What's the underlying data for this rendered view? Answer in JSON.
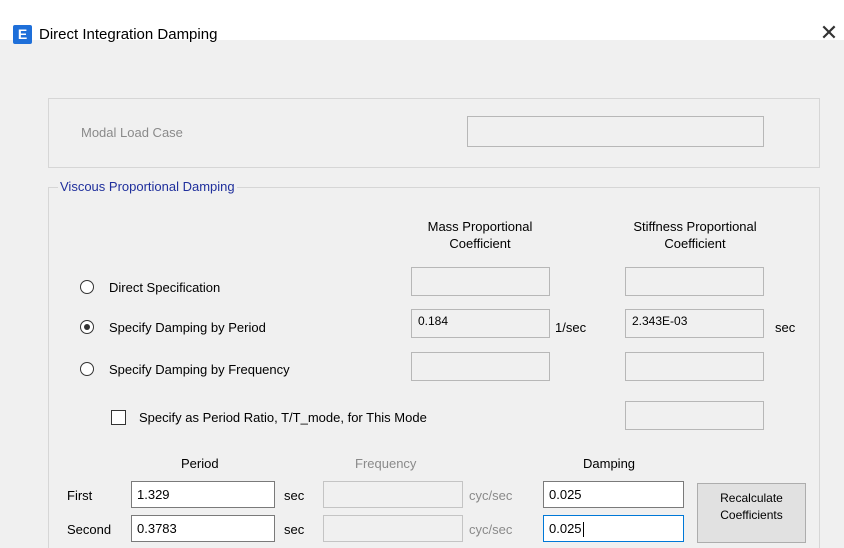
{
  "window": {
    "icon_letter": "E",
    "title": "Direct Integration Damping",
    "close_glyph": "✕"
  },
  "modal": {
    "label": "Modal Load Case",
    "value": ""
  },
  "viscous": {
    "legend": "Viscous Proportional Damping",
    "mass_header": "Mass Proportional\nCoefficient",
    "stiffness_header": "Stiffness Proportional\nCoefficient",
    "options": [
      {
        "label": "Direct Specification",
        "selected": false,
        "mass": "",
        "stiffness": ""
      },
      {
        "label": "Specify Damping by Period",
        "selected": true,
        "mass": "0.184",
        "mass_unit": "1/sec",
        "stiffness": "2.343E-03",
        "stiffness_unit": "sec"
      },
      {
        "label": "Specify Damping by Frequency",
        "selected": false,
        "mass": "",
        "stiffness": ""
      }
    ],
    "ratio_checkbox": {
      "label": "Specify as Period Ratio, T/T_mode, for This Mode",
      "checked": false,
      "value": ""
    }
  },
  "table": {
    "col_period": "Period",
    "col_frequency": "Frequency",
    "col_damping": "Damping",
    "rows": [
      {
        "label": "First",
        "period": "1.329",
        "period_unit": "sec",
        "frequency": "",
        "frequency_unit": "cyc/sec",
        "damping": "0.025"
      },
      {
        "label": "Second",
        "period": "0.3783",
        "period_unit": "sec",
        "frequency": "",
        "frequency_unit": "cyc/sec",
        "damping": "0.025"
      }
    ],
    "recalc_button": "Recalculate\nCoefficients"
  }
}
